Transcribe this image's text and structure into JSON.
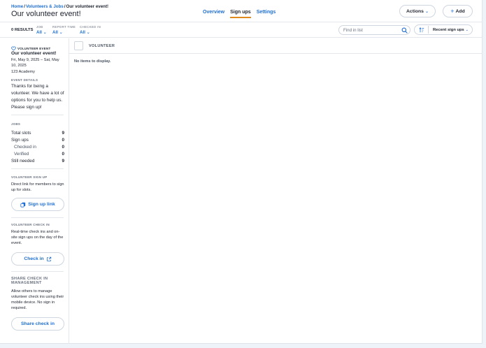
{
  "breadcrumb": {
    "home": "Home",
    "sep": "/",
    "section": "Volunteers & Jobs",
    "current": "Our volunteer event!"
  },
  "page_title": "Our volunteer event!",
  "tabs": [
    {
      "label": "Overview",
      "active": false
    },
    {
      "label": "Sign ups",
      "active": true
    },
    {
      "label": "Settings",
      "active": false
    }
  ],
  "header_buttons": {
    "actions": "Actions",
    "add": "Add"
  },
  "filters": {
    "results": "0 RESULTS",
    "job": {
      "label": "JOB",
      "value": "All"
    },
    "report_time": {
      "label": "REPORT TIME",
      "value": "All"
    },
    "checked_in": {
      "label": "CHECKED IN",
      "value": "All"
    }
  },
  "search": {
    "placeholder": "Find in list",
    "value": ""
  },
  "sort": {
    "label": "Recent sign ups"
  },
  "sidebar": {
    "event_label": "VOLUNTEER EVENT",
    "event_title": "Our volunteer event!",
    "event_dates": "Fri, May 9, 2025 – Sat, May 10, 2025",
    "event_location": "123 Academy",
    "details_label": "EVENT DETAILS",
    "details_text": "Thanks for being a volunteer. We have a lot of options for you to help us. Please sign up!",
    "jobs_label": "JOBS",
    "stats": [
      {
        "label": "Total slots",
        "value": "9",
        "sub": false
      },
      {
        "label": "Sign ups",
        "value": "0",
        "sub": false
      },
      {
        "label": "Checked in",
        "value": "0",
        "sub": true
      },
      {
        "label": "Verified",
        "value": "0",
        "sub": true
      },
      {
        "label": "Still needed",
        "value": "9",
        "sub": false
      }
    ],
    "signup_label": "VOLUNTEER SIGN UP",
    "signup_text": "Direct link for members to sign up for slots.",
    "signup_button": "Sign up link",
    "checkin_label": "VOLUNTEER CHECK IN",
    "checkin_text": "Real-time check ins and on-site sign ups on the day of the event.",
    "checkin_button": "Check in",
    "share_label": "SHARE CHECK IN MANAGEMENT",
    "share_text": "Allow others to manage volunteer check ins using their mobile device. No sign in required.",
    "share_button": "Share check in"
  },
  "table": {
    "column": "VOLUNTEER",
    "empty": "No items to display."
  },
  "colors": {
    "accent": "#1f6fd1",
    "tab_underline": "#e08a1e",
    "border": "#e4e7ec"
  }
}
